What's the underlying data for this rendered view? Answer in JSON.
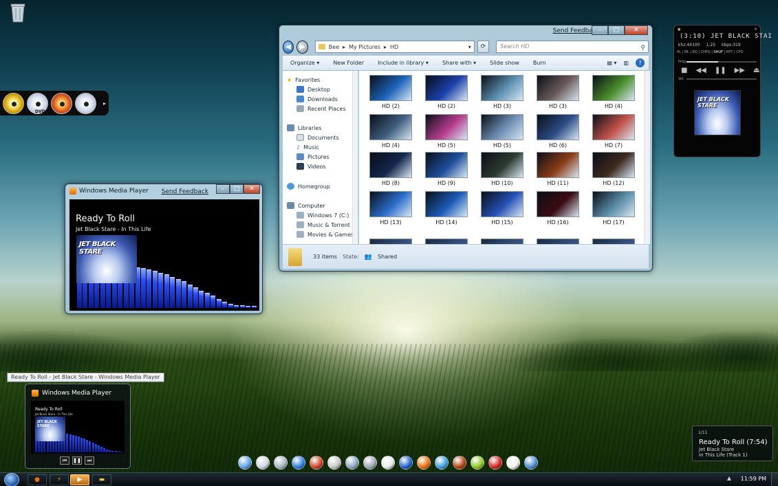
{
  "explorer": {
    "send_feedback": "Send Feedback",
    "breadcrumb": [
      "Bee",
      "My Pictures",
      "HD"
    ],
    "search_placeholder": "Search HD",
    "toolbar": [
      "Organize",
      "New Folder",
      "Include in library",
      "Share with",
      "Slide show",
      "Burn"
    ],
    "nav": {
      "favorites": "Favorites",
      "favorites_items": [
        "Desktop",
        "Downloads",
        "Recent Places"
      ],
      "libraries": "Libraries",
      "libraries_items": [
        "Documents",
        "Music",
        "Pictures",
        "Videos"
      ],
      "homegroup": "Homegroup",
      "computer": "Computer",
      "computer_items": [
        "Windows 7 (C:)",
        "Music & Torrent",
        "Movies & Games"
      ]
    },
    "thumbnails": [
      {
        "label": "HD (2)",
        "color": "#1d63b8"
      },
      {
        "label": "HD (2)",
        "color": "#1b3fa8"
      },
      {
        "label": "HD (3)",
        "color": "#5c8fb0"
      },
      {
        "label": "HD (3)",
        "color": "#6b5a58"
      },
      {
        "label": "HD (4)",
        "color": "#4a8c2a"
      },
      {
        "label": "HD (4)",
        "color": "#405e80"
      },
      {
        "label": "HD (5)",
        "color": "#b43c8c"
      },
      {
        "label": "HD (5)",
        "color": "#6e8eb4"
      },
      {
        "label": "HD (6)",
        "color": "#2c4a84"
      },
      {
        "label": "HD (7)",
        "color": "#c0504a"
      },
      {
        "label": "HD (8)",
        "color": "#14264c"
      },
      {
        "label": "HD (9)",
        "color": "#1e4e9c"
      },
      {
        "label": "HD (10)",
        "color": "#2c3a30"
      },
      {
        "label": "HD (11)",
        "color": "#8a3c18"
      },
      {
        "label": "HD (12)",
        "color": "#3e2a20"
      },
      {
        "label": "HD (13)",
        "color": "#2a6cc8"
      },
      {
        "label": "HD (14)",
        "color": "#1a5ab4"
      },
      {
        "label": "HD (15)",
        "color": "#2450b4"
      },
      {
        "label": "HD (16)",
        "color": "#3a0c12"
      },
      {
        "label": "HD (17)",
        "color": "#5a8ca8"
      }
    ],
    "item_count": "33 items",
    "state_label": "State:",
    "state_value": "Shared"
  },
  "wmp": {
    "window_title": "Windows Media Player",
    "send_feedback": "Send Feedback",
    "song_title": "Ready To Roll",
    "song_sub": "Jet Black Stare - In This Life",
    "album_text": "JET BLACK STARE",
    "visualizer_levels": [
      0.72,
      0.72,
      0.74,
      0.74,
      0.75,
      0.74,
      0.74,
      0.72,
      0.7,
      0.68,
      0.66,
      0.64,
      0.62,
      0.6,
      0.57,
      0.54,
      0.5,
      0.47,
      0.43,
      0.38,
      0.33,
      0.28,
      0.24,
      0.2,
      0.15,
      0.1,
      0.07,
      0.05,
      0.04,
      0.03,
      0.03
    ]
  },
  "tooltip": "Ready To Roll - Jet Black Stare - Windows Media Player",
  "preview": {
    "title": "Windows Media Player",
    "song_title": "Ready To Roll",
    "song_sub": "Jet Black Stare - In This Life",
    "album_text": "JET BLACK STARE"
  },
  "right_player": {
    "time_title": "(3:10)  JET BLACK STAI",
    "khz": "khz:44100",
    "elapsed": "1:25",
    "kbps": "kbps:319",
    "menu": [
      "PL",
      "ML",
      "EQ",
      "CHFG",
      "SHUF",
      "RPT",
      "CFD"
    ],
    "menu_active": "SHUF",
    "prog_label": "Prog",
    "vol_label": "Vol",
    "progress": 0.45,
    "album_text": "JET BLACK STARE"
  },
  "notification": {
    "counter": "1/11",
    "title": "Ready To Roll (7:54)",
    "artist": "Jet Black Stare",
    "album": "In This Life (Track 1)"
  },
  "clock": "11:59 PM",
  "dock_colors": [
    "#5aa0e6",
    "#cfd6de",
    "#a8b4c0",
    "#2a7ad8",
    "#d04020",
    "#c8c8c8",
    "#8aa4c0",
    "#9aa6b2",
    "#e8e8e8",
    "#1c5ec8",
    "#e8700c",
    "#3c9ae0",
    "#b04010",
    "#8cc820",
    "#d42020",
    "#f0f0f0",
    "#4a8ad0"
  ]
}
